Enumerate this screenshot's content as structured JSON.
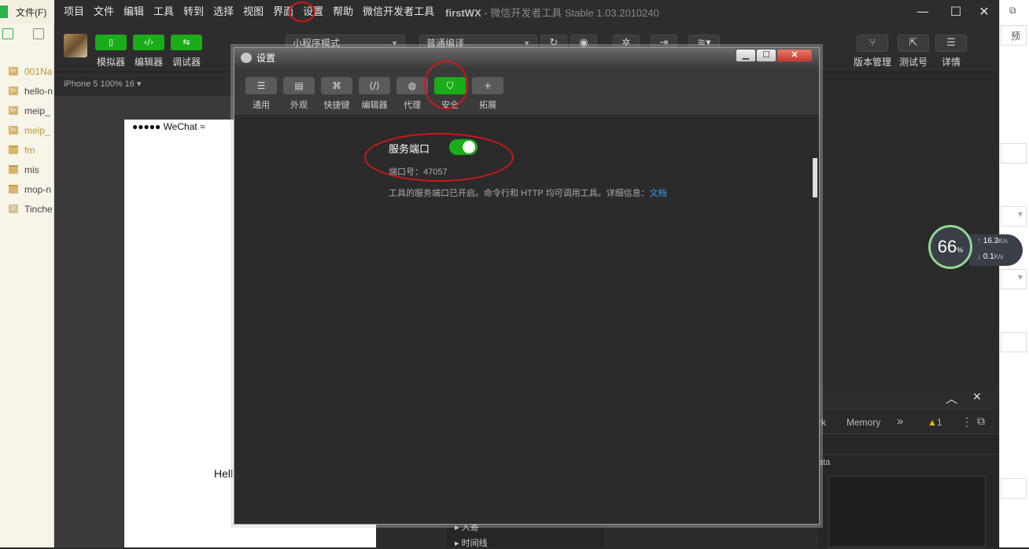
{
  "left_app": {
    "menu_file": "文件(F)",
    "tree": [
      {
        "label": "001Na",
        "icon": "5+"
      },
      {
        "label": "hello-n",
        "icon": "5+"
      },
      {
        "label": "meip_",
        "icon": "5+"
      },
      {
        "label": "meip_",
        "icon": "5+"
      },
      {
        "label": "fm",
        "icon": "folder"
      },
      {
        "label": "mis",
        "icon": "folder"
      },
      {
        "label": "mop-n",
        "icon": "folder"
      },
      {
        "label": "Tinche",
        "icon": "U"
      }
    ]
  },
  "menubar": {
    "items": [
      "项目",
      "文件",
      "编辑",
      "工具",
      "转到",
      "选择",
      "视图",
      "界面",
      "设置",
      "帮助",
      "微信开发者工具"
    ],
    "project": "firstWX",
    "app_title": " - 微信开发者工具 Stable 1.03.2010240"
  },
  "toolbar": {
    "simulator": "模拟器",
    "editor": "编辑器",
    "debugger": "调试器",
    "mode_select": "小程序模式",
    "compile_select": "普通编译",
    "version_mgmt": "版本管理",
    "test_account": "测试号",
    "details": "详情"
  },
  "simulator": {
    "device": "iPhone 5 100% 16 ▾",
    "status": "●●●●● WeChat",
    "hello": "Hell"
  },
  "debugger": {
    "tab_network": "rk",
    "tab_memory": "Memory",
    "more": "»",
    "warnings": "1",
    "data_label": "ata",
    "tree_items": [
      "入寄",
      "时间线"
    ]
  },
  "right_app": {
    "preview": "预"
  },
  "network_widget": {
    "percent": "66",
    "percent_unit": "%",
    "upload": "16.3",
    "download": "0.1",
    "unit": "K/s"
  },
  "settings": {
    "title": "设置",
    "tabs": [
      {
        "label": "通用",
        "icon": "list-icon",
        "glyph": "☰"
      },
      {
        "label": "外观",
        "icon": "layout-icon",
        "glyph": "▤"
      },
      {
        "label": "快捷键",
        "icon": "command-icon",
        "glyph": "⌘"
      },
      {
        "label": "编辑器",
        "icon": "code-icon",
        "glyph": "⟨/⟩"
      },
      {
        "label": "代理",
        "icon": "globe-icon",
        "glyph": "◍"
      },
      {
        "label": "安全",
        "icon": "shield-icon",
        "glyph": "⛉",
        "active": true
      },
      {
        "label": "拓展",
        "icon": "plus-icon",
        "glyph": "+"
      }
    ],
    "service_port_label": "服务端口",
    "service_port_enabled": true,
    "port_number_label": "端口号：47057",
    "description": "工具的服务端口已开启。命令行和 HTTP 均可调用工具。详细信息：",
    "doc_link": "文档"
  },
  "colors": {
    "accent_green": "#1aad19",
    "annotation_red": "#d01818",
    "link_blue": "#3a9af2"
  }
}
